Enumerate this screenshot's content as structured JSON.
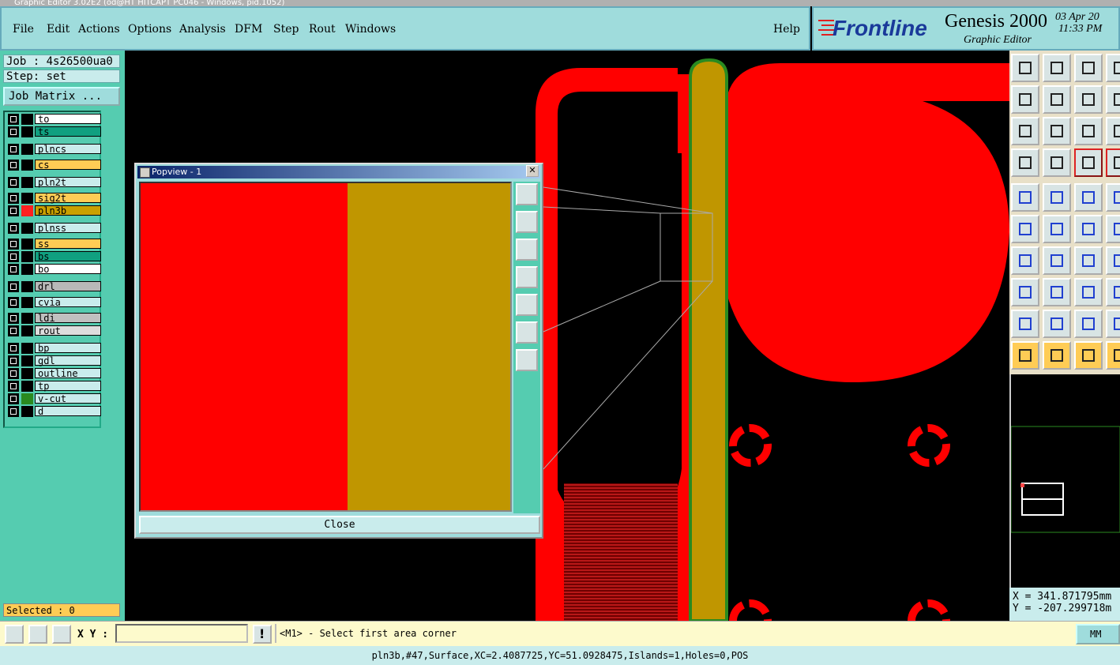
{
  "window": {
    "title": "Graphic Editor 3.02E2 (od@HT HITCAPT PC046 - Windows, pid.1052)"
  },
  "menu": {
    "items": [
      "File",
      "Edit",
      "Actions",
      "Options",
      "Analysis",
      "DFM",
      "Step",
      "Rout",
      "Windows"
    ],
    "help": "Help"
  },
  "brand": {
    "logo": "Frontline",
    "product": "Genesis 2000",
    "subtitle": "Graphic Editor",
    "date": "03 Apr 20",
    "time": "11:33 PM"
  },
  "left": {
    "job": "Job : 4s26500ua0",
    "step": "Step: set",
    "job_matrix": "Job Matrix ...",
    "selected": "Selected : 0"
  },
  "layers": [
    {
      "name": "to",
      "color": "#ffffff",
      "sw": "#000000"
    },
    {
      "name": "ts",
      "color": "#10a080",
      "sw": "#000000"
    },
    {
      "name": "plncs",
      "color": "#c9ecec",
      "sw": "#000000"
    },
    {
      "name": "cs",
      "color": "#ffcc55",
      "sw": "#000000"
    },
    {
      "name": "pln2t",
      "color": "#c9ecec",
      "sw": "#000000"
    },
    {
      "name": "sig2t",
      "color": "#ffcc55",
      "sw": "#000000"
    },
    {
      "name": "pln3b",
      "color": "#c9a000",
      "sw": "#ff2020"
    },
    {
      "name": "plnss",
      "color": "#c9ecec",
      "sw": "#000000"
    },
    {
      "name": "ss",
      "color": "#ffcc55",
      "sw": "#000000"
    },
    {
      "name": "bs",
      "color": "#10a080",
      "sw": "#000000"
    },
    {
      "name": "bo",
      "color": "#ffffff",
      "sw": "#000000"
    },
    {
      "name": "drl",
      "color": "#b8b8b8",
      "sw": "#000000"
    },
    {
      "name": "cvia",
      "color": "#c9ecec",
      "sw": "#000000"
    },
    {
      "name": "ldi",
      "color": "#c0c0c0",
      "sw": "#000000"
    },
    {
      "name": "rout",
      "color": "#dddddd",
      "sw": "#000000"
    },
    {
      "name": "bp",
      "color": "#c9ecec",
      "sw": "#000000"
    },
    {
      "name": "gdl",
      "color": "#c9ecec",
      "sw": "#000000"
    },
    {
      "name": "outline",
      "color": "#c9ecec",
      "sw": "#000000"
    },
    {
      "name": "tp",
      "color": "#c9ecec",
      "sw": "#000000"
    },
    {
      "name": "v-cut",
      "color": "#c9ecec",
      "sw": "#2a8a20"
    },
    {
      "name": "d",
      "color": "#c9ecec",
      "sw": "#000000"
    }
  ],
  "popview": {
    "title": "Popview - 1",
    "close": "Close"
  },
  "coords": {
    "x": "X = 341.871795mm",
    "y": "Y = -207.299718m"
  },
  "bottom": {
    "xy_label": "X Y :",
    "xy_value": "",
    "prompt": "<M1> - Select first area corner",
    "unit": "MM",
    "status": "pln3b,#47,Surface,XC=2.4087725,YC=51.0928475,Islands=1,Holes=0,POS"
  },
  "colors": {
    "copper": "#ff0000",
    "selected_layer": "#c09600",
    "panel": "#55ccb0",
    "menu": "#9fdcdc"
  }
}
